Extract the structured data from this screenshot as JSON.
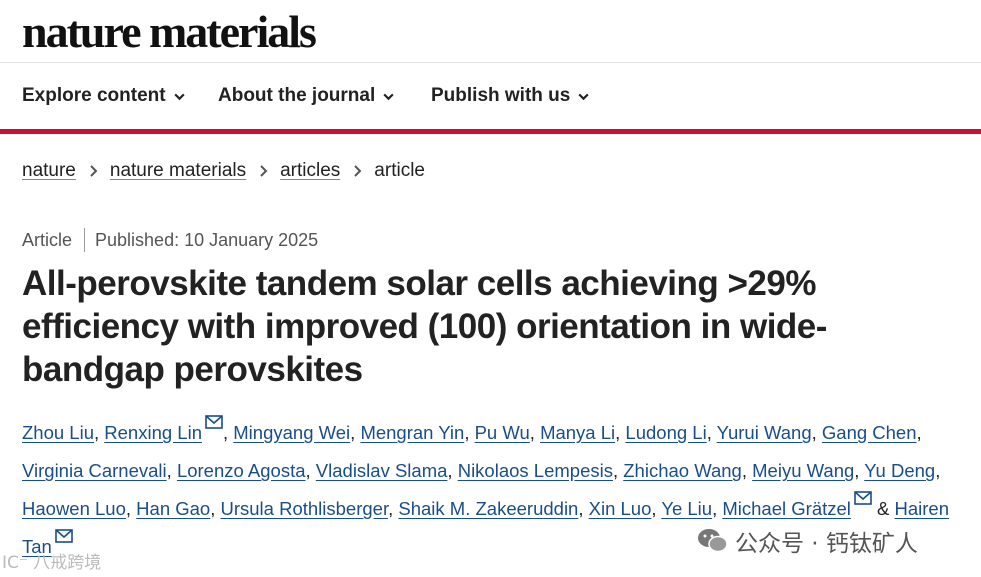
{
  "site": {
    "logo": "nature materials"
  },
  "nav": {
    "items": [
      "Explore content",
      "About the journal",
      "Publish with us"
    ]
  },
  "breadcrumb": {
    "items": [
      "nature",
      "nature materials",
      "articles"
    ],
    "current": "article"
  },
  "article": {
    "type": "Article",
    "published": "Published: 10 January 2025",
    "title": "All-perovskite tandem solar cells achieving >29% efficiency with improved (100) orientation in wide-bandgap perovskites",
    "authors": [
      "Zhou Liu",
      "Renxing Lin",
      "Mingyang Wei",
      "Mengran Yin",
      "Pu Wu",
      "Manya Li",
      "Ludong Li",
      "Yurui Wang",
      "Gang Chen",
      "Virginia Carnevali",
      "Lorenzo Agosta",
      "Vladislav Slama",
      "Nikolaos Lempesis",
      "Zhichao Wang",
      "Meiyu Wang",
      "Yu Deng",
      "Haowen Luo",
      "Han Gao",
      "Ursula Rothlisberger",
      "Shaik M. Zakeeruddin",
      "Xin Luo",
      "Ye Liu",
      "Michael Grätzel",
      "Hairen Tan"
    ],
    "ampersand": "&"
  },
  "watermark": {
    "right": "公众号 · 钙钛矿人",
    "left": "IC⁻ 八戒跨境"
  },
  "colors": {
    "accent": "#c8102e",
    "link": "#1a4e8a"
  },
  "icons": [
    "chevron-down-icon",
    "chevron-right-icon",
    "mail-icon",
    "wechat-icon"
  ]
}
